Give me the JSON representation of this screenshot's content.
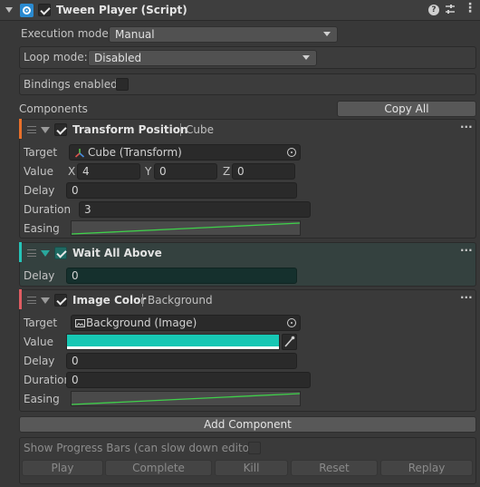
{
  "header": {
    "title": "Tween Player (Script)",
    "enabled": true
  },
  "settings": {
    "execution_mode_label": "Execution mode:",
    "execution_mode_value": "Manual",
    "loop_mode_label": "Loop mode:",
    "loop_mode_value": "Disabled",
    "bindings_label": "Bindings enabled",
    "bindings_enabled": false
  },
  "components_section": {
    "label": "Components",
    "copy_all_label": "Copy All"
  },
  "components": [
    {
      "title": "Transform Position",
      "target_name": "Cube",
      "accent_color": "#e8702a",
      "enabled": true,
      "target_label": "Target",
      "target_value": "Cube (Transform)",
      "value_label": "Value",
      "x_label": "X",
      "x_value": "4",
      "y_label": "Y",
      "y_value": "0",
      "z_label": "Z",
      "z_value": "0",
      "delay_label": "Delay",
      "delay_value": "0",
      "duration_label": "Duration",
      "duration_value": "3",
      "easing_label": "Easing"
    },
    {
      "title": "Wait All Above",
      "accent_color": "#25c4b8",
      "enabled": true,
      "delay_label": "Delay",
      "delay_value": "0"
    },
    {
      "title": "Image Color",
      "target_name": "Background",
      "accent_color": "#e05c62",
      "enabled": true,
      "target_label": "Target",
      "target_value": "Background (Image)",
      "value_label": "Value",
      "color_value": "#17c7b4",
      "delay_label": "Delay",
      "delay_value": "0",
      "duration_label": "Duration",
      "duration_value": "0",
      "easing_label": "Easing"
    }
  ],
  "add_component_label": "Add Component",
  "progress": {
    "label": "Show Progress Bars (can slow down editor)",
    "enabled": false
  },
  "controls": {
    "play": "Play",
    "complete": "Complete",
    "kill": "Kill",
    "reset": "Reset",
    "replay": "Replay"
  },
  "colors": {
    "background": "#383838",
    "easing_curve": "#3fd04a"
  }
}
